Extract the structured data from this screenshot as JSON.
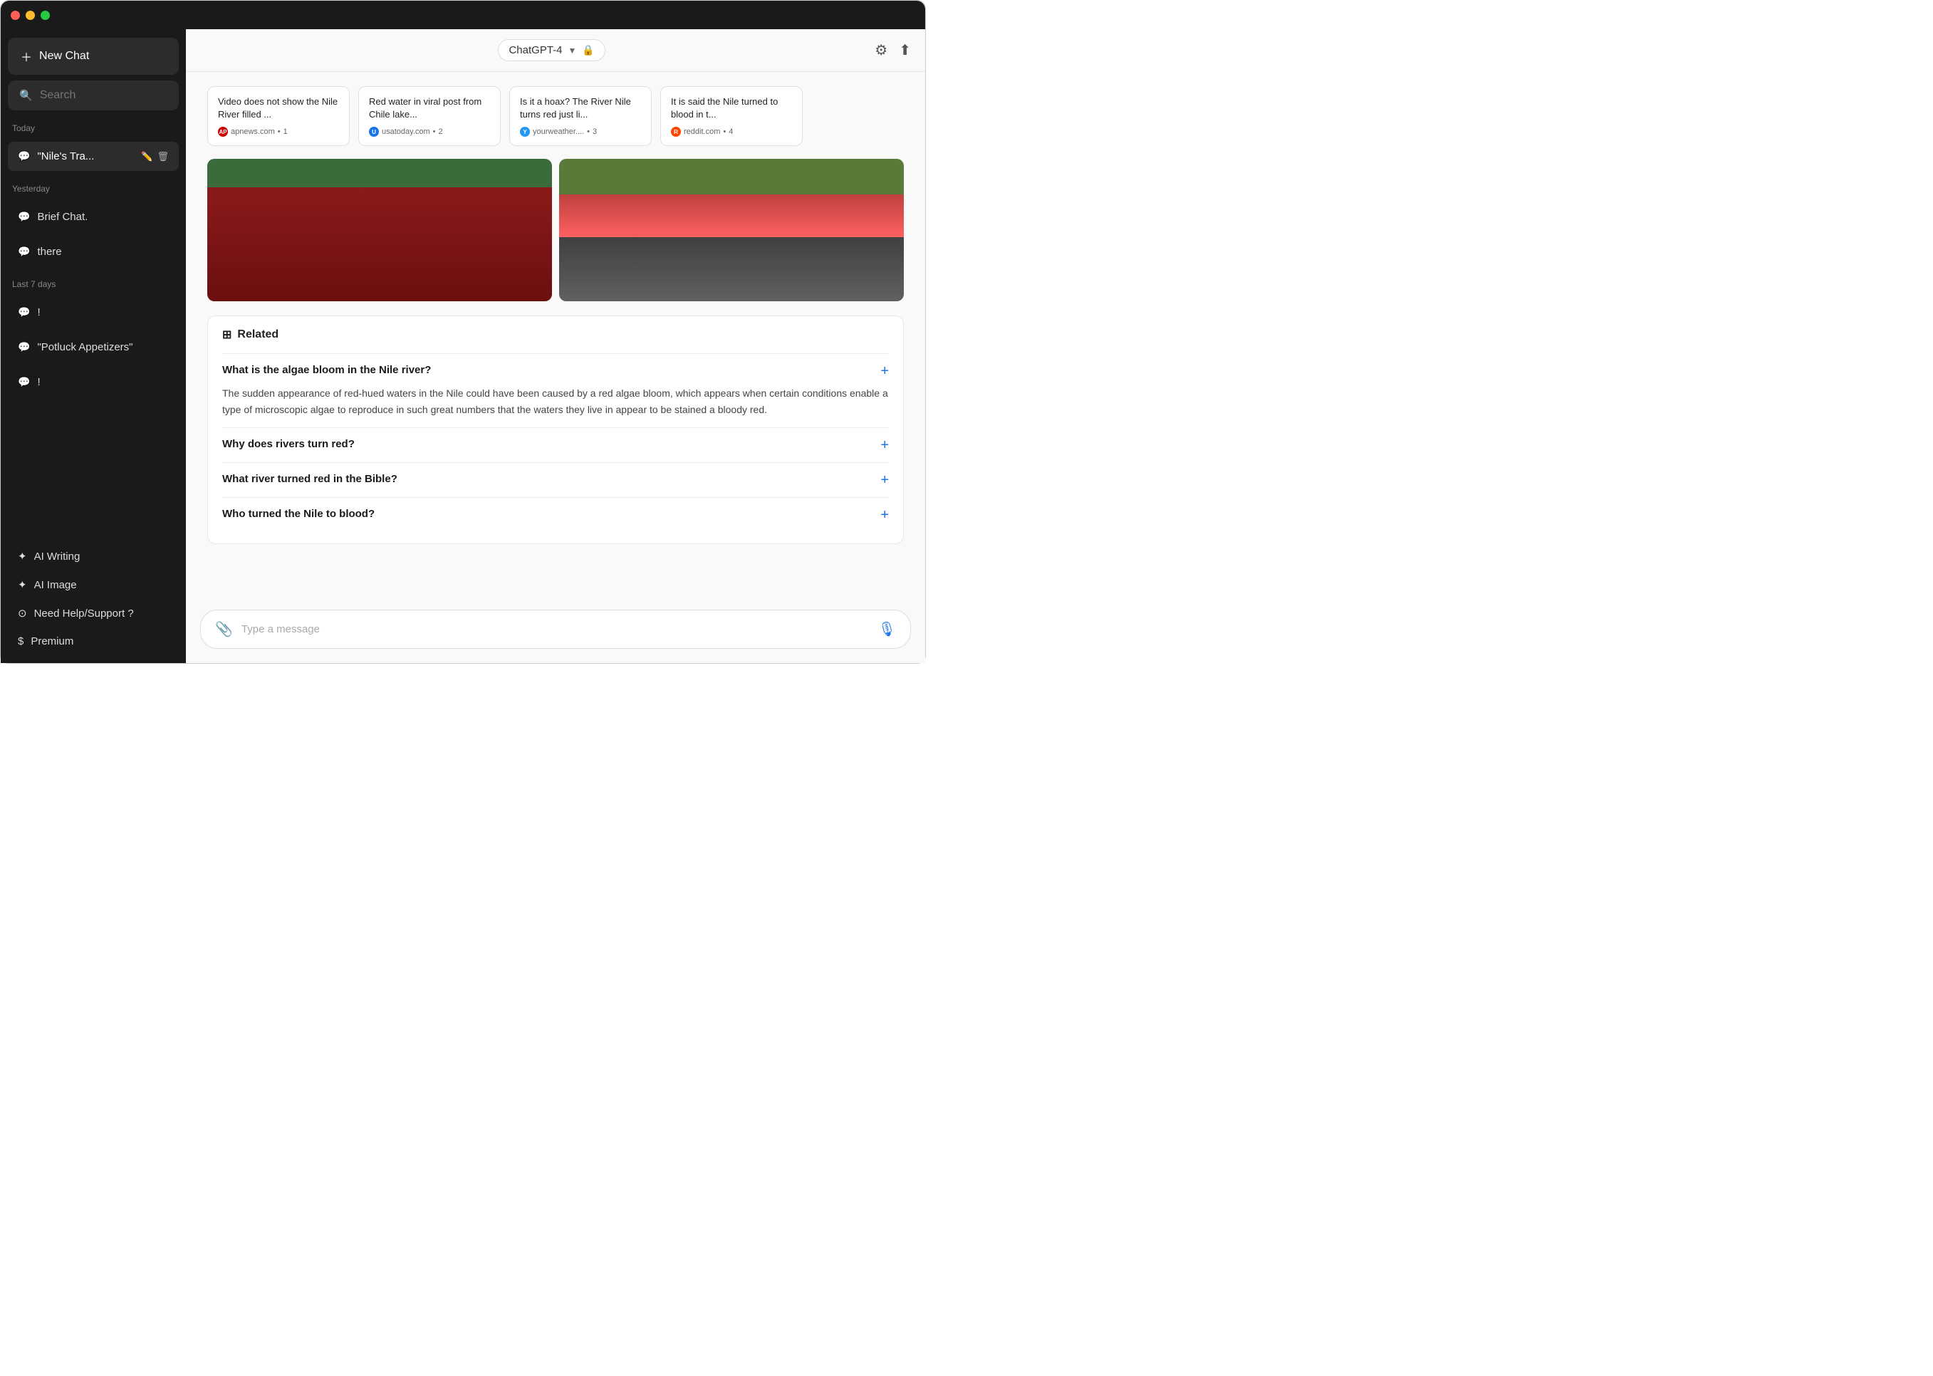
{
  "titlebar": {
    "dots": [
      "red",
      "yellow",
      "green"
    ]
  },
  "sidebar": {
    "new_chat_label": "New Chat",
    "search_placeholder": "Search",
    "sections": [
      {
        "label": "Today",
        "items": [
          {
            "id": "niles-tra",
            "text": "\"Nile's Tra...",
            "active": true
          }
        ]
      },
      {
        "label": "Yesterday",
        "items": [
          {
            "id": "brief-chat",
            "text": "Brief Chat.",
            "active": false
          },
          {
            "id": "there",
            "text": "there",
            "active": false
          }
        ]
      },
      {
        "label": "Last 7 days",
        "items": [
          {
            "id": "exclaim1",
            "text": "!",
            "active": false
          },
          {
            "id": "potluck",
            "text": "\"Potluck Appetizers\"",
            "active": false
          },
          {
            "id": "exclaim2",
            "text": "!",
            "active": false
          }
        ]
      }
    ],
    "tools": [
      {
        "id": "ai-writing",
        "icon": "✦",
        "label": "AI Writing"
      },
      {
        "id": "ai-image",
        "icon": "✦",
        "label": "AI Image"
      },
      {
        "id": "support",
        "icon": "⊙",
        "label": "Need Help/Support ?"
      },
      {
        "id": "premium",
        "icon": "$",
        "label": "Premium"
      }
    ]
  },
  "topbar": {
    "model": "ChatGPT-4",
    "model_icon": "🔒",
    "settings_icon": "⚙",
    "share_icon": "⬆"
  },
  "sources": [
    {
      "title": "Video does not show the Nile River filled ...",
      "domain": "apnews.com",
      "dot_class": "dot-ap",
      "dot_label": "AP",
      "count": "1"
    },
    {
      "title": "Red water in viral post from Chile lake...",
      "domain": "usatoday.com",
      "dot_class": "dot-usa",
      "dot_label": "U",
      "count": "2"
    },
    {
      "title": "Is it a hoax? The River Nile turns red just li...",
      "domain": "yourweather....",
      "dot_class": "dot-yw",
      "dot_label": "Y",
      "count": "3"
    },
    {
      "title": "It is said the Nile turned to blood in t...",
      "domain": "reddit.com",
      "dot_class": "dot-reddit",
      "dot_label": "R",
      "count": "4"
    }
  ],
  "related": {
    "header": "Related",
    "icon": "⊞",
    "faqs": [
      {
        "question": "What is the algae bloom in the Nile river?",
        "answer": "The sudden appearance of red-hued waters in the Nile could have been caused by a red algae bloom, which appears when certain conditions enable a type of microscopic algae to reproduce in such great numbers that the waters they live in appear to be stained a bloody red.",
        "expanded": true
      },
      {
        "question": "Why does rivers turn red?",
        "answer": "",
        "expanded": false
      },
      {
        "question": "What river turned red in the Bible?",
        "answer": "",
        "expanded": false
      },
      {
        "question": "Who turned the Nile to blood?",
        "answer": "",
        "expanded": false
      }
    ]
  },
  "input": {
    "placeholder": "Type a message",
    "attach_icon": "📎",
    "mic_icon": "🎙"
  }
}
